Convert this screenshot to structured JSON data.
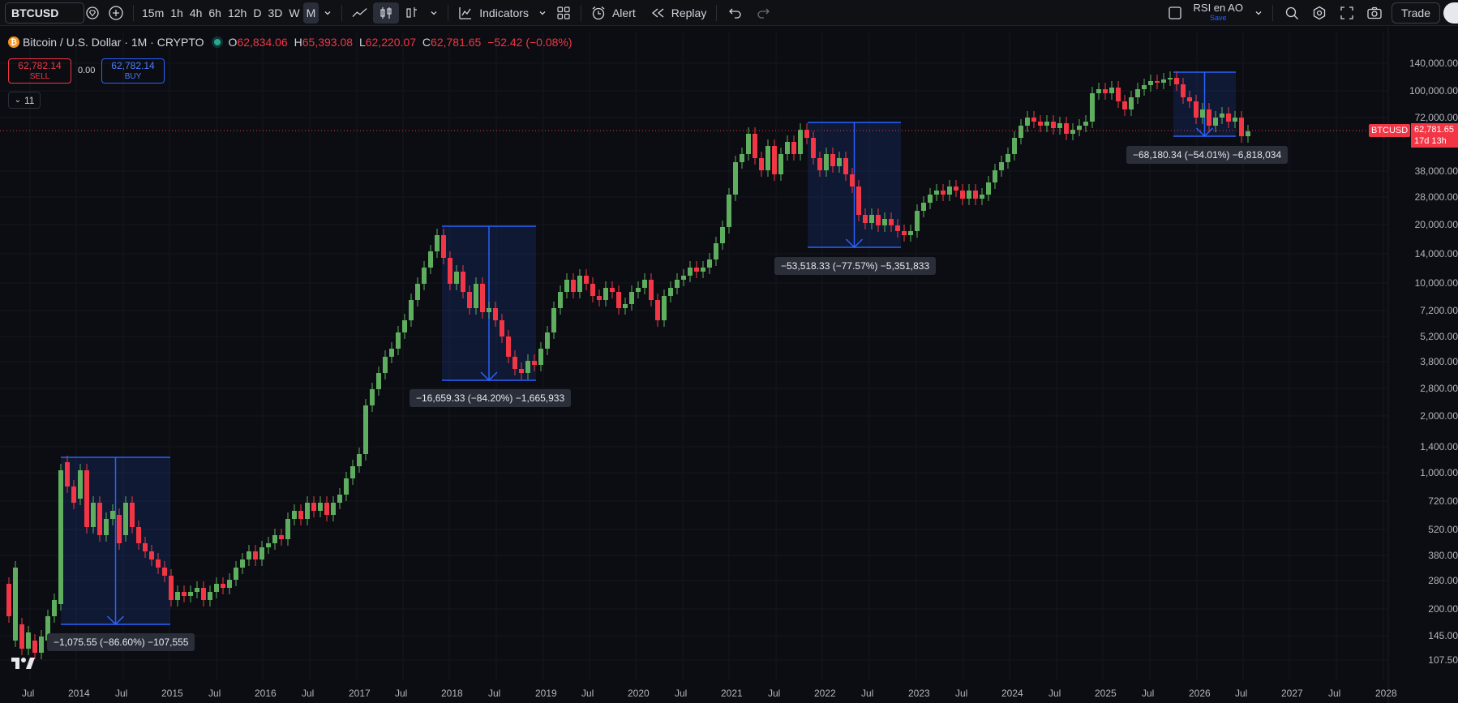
{
  "toolbar": {
    "symbol": "BTCUSD",
    "timeframes": [
      "15m",
      "1h",
      "4h",
      "6h",
      "12h",
      "D",
      "3D",
      "W",
      "M"
    ],
    "active_timeframe": "M",
    "indicators_label": "Indicators",
    "alert_label": "Alert",
    "replay_label": "Replay",
    "layout_name": "RSI en AO",
    "layout_status": "Save",
    "trade_label": "Trade"
  },
  "legend": {
    "title": "Bitcoin / U.S. Dollar · 1M · CRYPTO",
    "open_label": "O",
    "open": "62,834.06",
    "high_label": "H",
    "high": "65,393.08",
    "low_label": "L",
    "low": "62,220.07",
    "close_label": "C",
    "close": "62,781.65",
    "change": "−52.42 (−0.08%)"
  },
  "trade": {
    "sell_price": "62,782.14",
    "sell_label": "SELL",
    "spread": "0.00",
    "buy_price": "62,782.14",
    "buy_label": "BUY",
    "collapse_count": "11"
  },
  "price_badge": {
    "symbol": "BTCUSD",
    "price": "62,781.65",
    "countdown": "17d 13h"
  },
  "price_scale": [
    "140,000.00",
    "100,000.00",
    "72,000.00",
    "38,000.00",
    "28,000.00",
    "20,000.00",
    "14,000.00",
    "10,000.00",
    "7,200.00",
    "5,200.00",
    "3,800.00",
    "2,800.00",
    "2,000.00",
    "1,400.00",
    "1,000.00",
    "720.00",
    "520.00",
    "380.00",
    "280.00",
    "200.00",
    "145.00",
    "107.50"
  ],
  "time_scale": [
    "Jul",
    "2014",
    "Jul",
    "2015",
    "Jul",
    "2016",
    "Jul",
    "2017",
    "Jul",
    "2018",
    "Jul",
    "2019",
    "Jul",
    "2020",
    "Jul",
    "2021",
    "Jul",
    "2022",
    "Jul",
    "2023",
    "Jul",
    "2024",
    "Jul",
    "2025",
    "Jul",
    "2026",
    "Jul",
    "2027",
    "Jul",
    "2028"
  ],
  "measurements": [
    {
      "label": "−1,075.55 (−86.60%) −107,555"
    },
    {
      "label": "−16,659.33 (−84.20%) −1,665,933"
    },
    {
      "label": "−53,518.33 (−77.57%) −5,351,833"
    },
    {
      "label": "−68,180.34 (−54.01%) −6,818,034"
    }
  ],
  "colors": {
    "up": "#5fae5f",
    "down": "#f23645",
    "accent": "#2962ff",
    "background": "#0b0d12"
  }
}
